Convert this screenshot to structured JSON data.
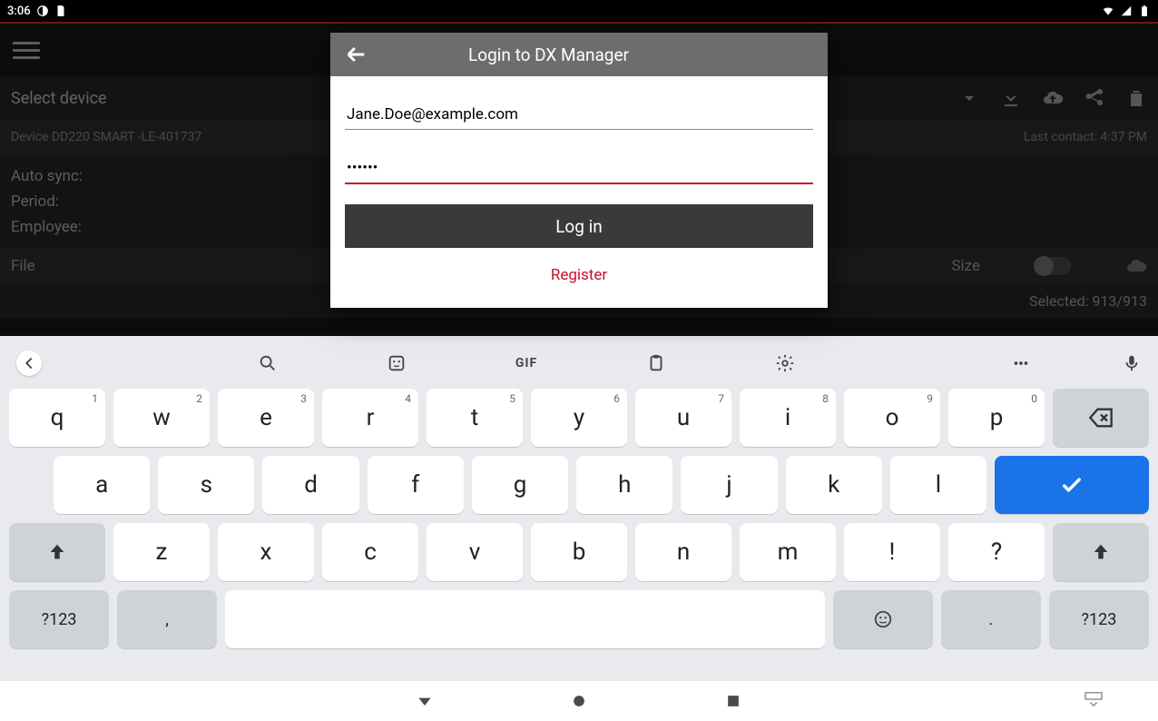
{
  "statusbar": {
    "time": "3:06"
  },
  "app": {
    "select_device": "Select device",
    "device_name": "Device DD220 SMART -LE-401737",
    "last_contact_label": "Last contact:",
    "last_contact_time": "4:37 PM",
    "auto_sync_label": "Auto sync:",
    "period_label": "Period:",
    "employee_label": "Employee:",
    "file_label": "File",
    "size_label": "Size",
    "selected_label": "Selected: 913/913"
  },
  "dialog": {
    "title": "Login to DX Manager",
    "email_value": "Jane.Doe@example.com",
    "password_value": "••••••",
    "login_btn": "Log in",
    "register_btn": "Register"
  },
  "keyboard": {
    "gif": "GIF",
    "row1": [
      {
        "k": "q",
        "s": "1"
      },
      {
        "k": "w",
        "s": "2"
      },
      {
        "k": "e",
        "s": "3"
      },
      {
        "k": "r",
        "s": "4"
      },
      {
        "k": "t",
        "s": "5"
      },
      {
        "k": "y",
        "s": "6"
      },
      {
        "k": "u",
        "s": "7"
      },
      {
        "k": "i",
        "s": "8"
      },
      {
        "k": "o",
        "s": "9"
      },
      {
        "k": "p",
        "s": "0"
      }
    ],
    "row2": [
      "a",
      "s",
      "d",
      "f",
      "g",
      "h",
      "j",
      "k",
      "l"
    ],
    "row3": [
      "z",
      "x",
      "c",
      "v",
      "b",
      "n",
      "m",
      "!",
      "?"
    ],
    "sym": "?123",
    "comma": ",",
    "period": "."
  }
}
